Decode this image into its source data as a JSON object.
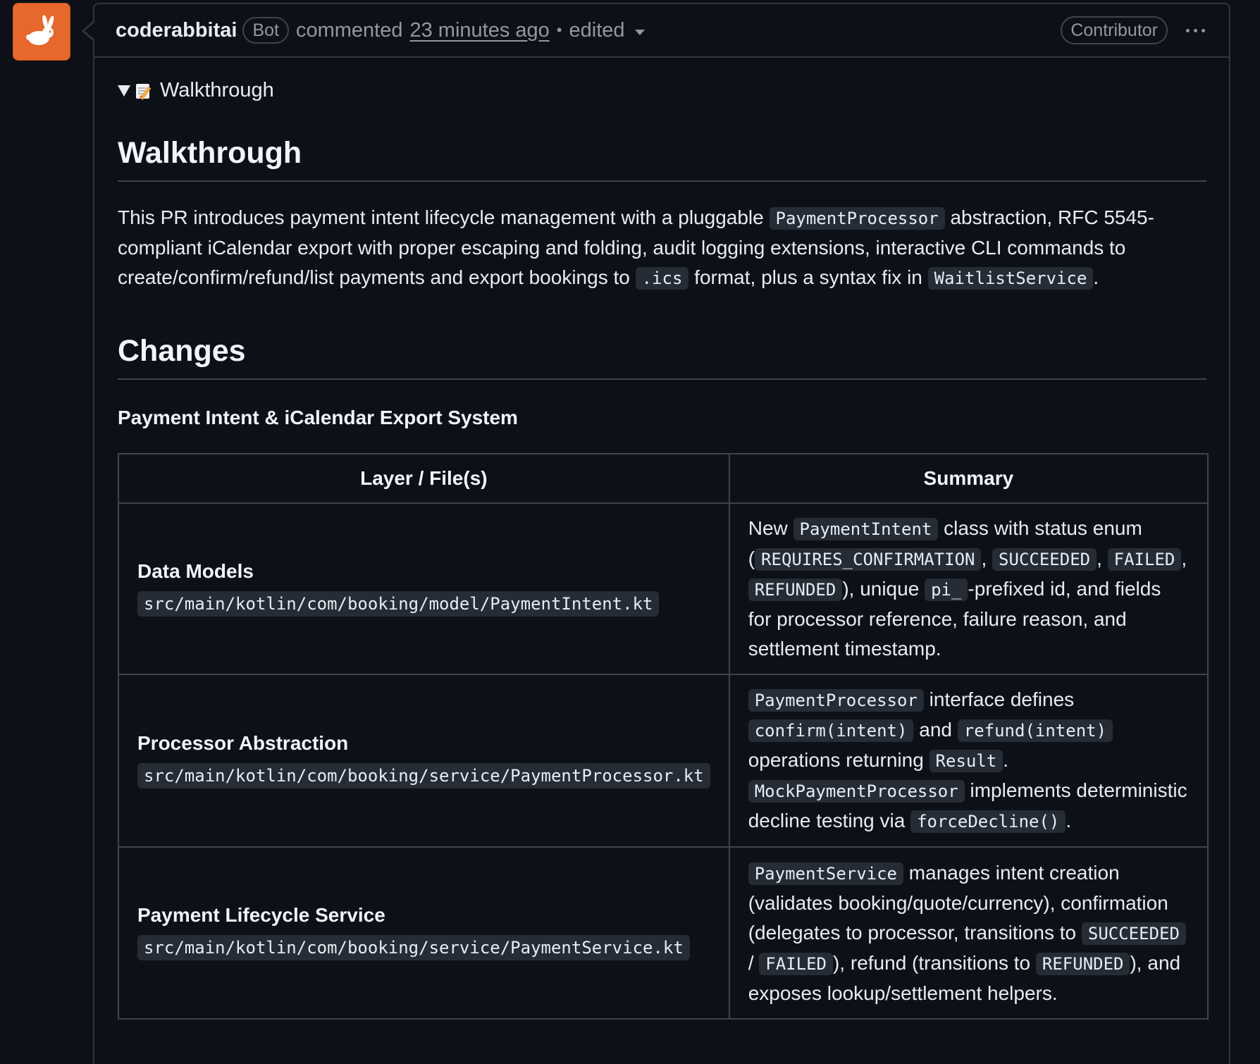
{
  "header": {
    "author": "coderabbitai",
    "bot_badge": "Bot",
    "action": "commented",
    "time": "23 minutes ago",
    "dot": "•",
    "edited": "edited",
    "role_badge": "Contributor"
  },
  "walkthrough_toggle": {
    "icon": "memo-icon",
    "label": "Walkthrough"
  },
  "walkthrough_heading": "Walkthrough",
  "intro": {
    "t1": "This PR introduces payment intent lifecycle management with a pluggable ",
    "c1": "PaymentProcessor",
    "t2": " abstraction, RFC 5545-compliant iCalendar export with proper escaping and folding, audit logging extensions, interactive CLI commands to create/confirm/refund/list payments and export bookings to ",
    "c2": ".ics",
    "t3": " format, plus a syntax fix in ",
    "c3": "WaitlistService",
    "t4": "."
  },
  "changes_heading": "Changes",
  "section_heading": "Payment Intent & iCalendar Export System",
  "table": {
    "col1": "Layer / File(s)",
    "col2": "Summary",
    "rows": [
      {
        "layer": "Data Models",
        "file": "src/main/kotlin/com/booking/model/PaymentIntent.kt",
        "s": {
          "t1": "New ",
          "c1": "PaymentIntent",
          "t2": " class with status enum (",
          "c2": "REQUIRES_CONFIRMATION",
          "t3": ", ",
          "c3": "SUCCEEDED",
          "t4": ", ",
          "c4": "FAILED",
          "t5": ", ",
          "c5": "REFUNDED",
          "t6": "), unique ",
          "c6": "pi_",
          "t7": "-prefixed id, and fields for processor reference, failure reason, and settlement timestamp."
        }
      },
      {
        "layer": "Processor Abstraction",
        "file": "src/main/kotlin/com/booking/service/PaymentProcessor.kt",
        "s": {
          "c1": "PaymentProcessor",
          "t1": " interface defines ",
          "c2": "confirm(intent)",
          "t2": " and ",
          "c3": "refund(intent)",
          "t3": " operations returning ",
          "c4": "Result",
          "t4": ". ",
          "c5": "MockPaymentProcessor",
          "t5": " implements deterministic decline testing via ",
          "c6": "forceDecline()",
          "t6": "."
        }
      },
      {
        "layer": "Payment Lifecycle Service",
        "file": "src/main/kotlin/com/booking/service/PaymentService.kt",
        "s": {
          "c1": "PaymentService",
          "t1": " manages intent creation (validates booking/quote/currency), confirmation (delegates to processor, transitions to ",
          "c2": "SUCCEEDED",
          "t2": " / ",
          "c3": "FAILED",
          "t3": "), refund (transitions to ",
          "c4": "REFUNDED",
          "t4": "), and exposes lookup/settlement helpers."
        }
      }
    ]
  },
  "colors": {
    "background": "#0d1117",
    "border": "#30363d",
    "avatar": "#e8672a",
    "text": "#e6edf3",
    "muted": "#9198a1",
    "code_bg": "#262c36"
  }
}
